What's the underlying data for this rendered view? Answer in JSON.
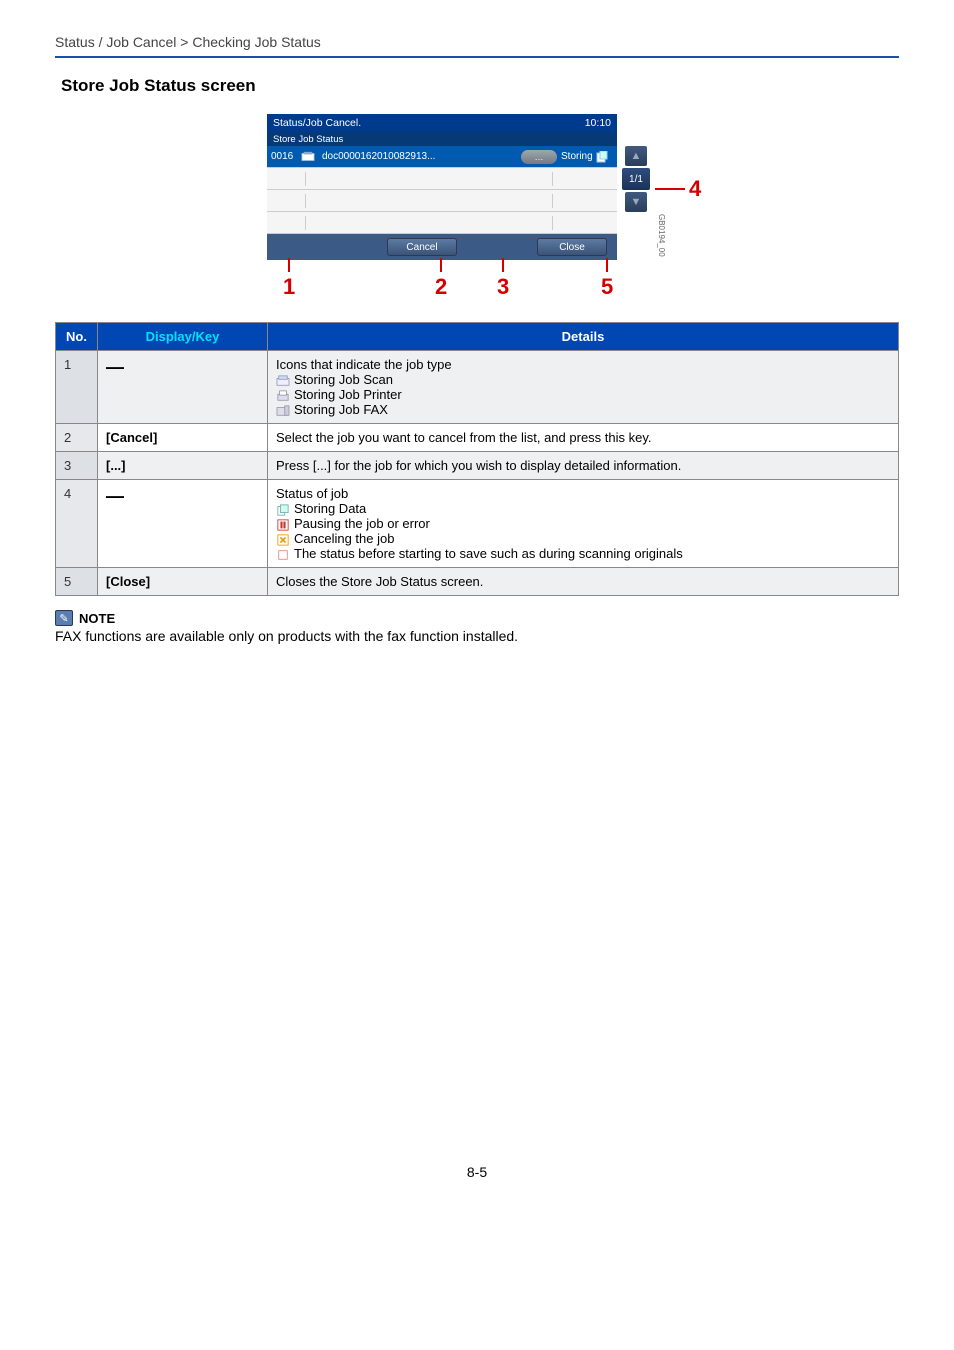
{
  "breadcrumb": "Status / Job Cancel > Checking Job Status",
  "section_title": "Store Job Status screen",
  "device": {
    "title": "Status/Job Cancel.",
    "time": "10:10",
    "subtitle": "Store Job Status",
    "row": {
      "no": "0016",
      "name": "doc0000162010082913...",
      "detail_btn": "…",
      "status": "Storing"
    },
    "page_indicator": "1/1",
    "cancel": "Cancel",
    "close": "Close",
    "sidecode": "GB0194_00"
  },
  "callouts": {
    "c1": "1",
    "c2": "2",
    "c3": "3",
    "c4": "4",
    "c5": "5"
  },
  "table": {
    "headers": {
      "no": "No.",
      "dk": "Display/Key",
      "dt": "Details"
    },
    "rows": [
      {
        "no": "1",
        "dk_is_dash": true,
        "details": {
          "lead": "Icons that indicate the job type",
          "items": [
            "Storing Job Scan",
            "Storing Job Printer",
            "Storing Job FAX"
          ]
        }
      },
      {
        "no": "2",
        "dk": "[Cancel]",
        "details": {
          "plain": "Select the job you want to cancel from the list, and press this key."
        }
      },
      {
        "no": "3",
        "dk": "[...]",
        "details": {
          "plain": "Press [...] for the job for which you wish to display detailed information."
        }
      },
      {
        "no": "4",
        "dk_is_dash": true,
        "details": {
          "lead": "Status of job",
          "items": [
            "Storing Data",
            "Pausing the job or error",
            "Canceling the job",
            "The status before starting to save such as during scanning originals"
          ]
        }
      },
      {
        "no": "5",
        "dk": "[Close]",
        "details": {
          "plain": "Closes the Store Job Status screen."
        }
      }
    ]
  },
  "note": {
    "label": "NOTE",
    "text": "FAX functions are available only on products with the fax function installed."
  },
  "page_number": "8-5"
}
